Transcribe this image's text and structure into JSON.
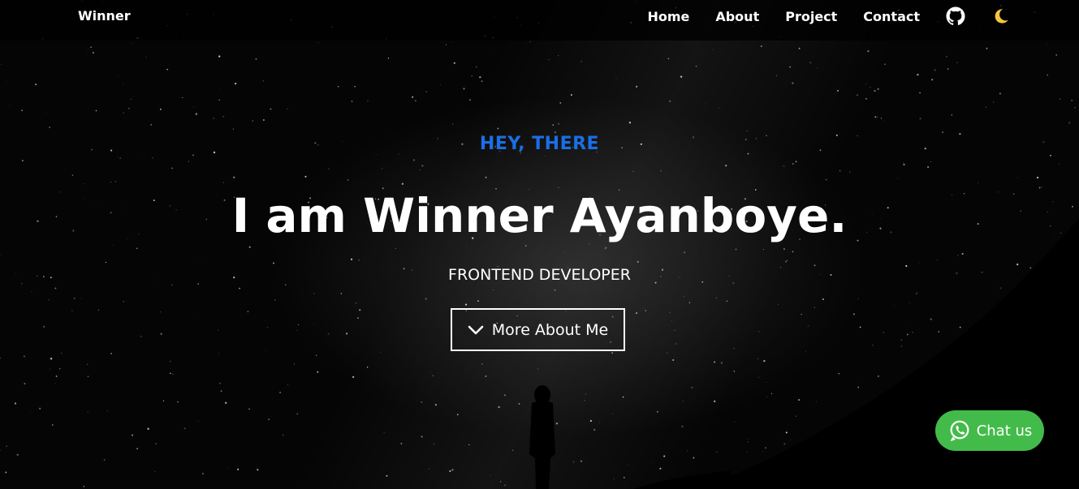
{
  "navbar": {
    "brand": "Winner",
    "links": [
      "Home",
      "About",
      "Project",
      "Contact"
    ],
    "github_icon": "github-icon",
    "theme_icon": "moon-icon"
  },
  "hero": {
    "eyebrow": "HEY, THERE",
    "headline": "I am Winner Ayanboye.",
    "subtitle": "FRONTEND DEVELOPER",
    "cta_label": "More About Me",
    "cta_icon": "chevron-down-icon"
  },
  "chat": {
    "label": "Chat us",
    "icon": "whatsapp-icon"
  },
  "colors": {
    "accent": "#1a6fe6",
    "chat_green": "#43bb4a",
    "moon": "#f5c542"
  }
}
